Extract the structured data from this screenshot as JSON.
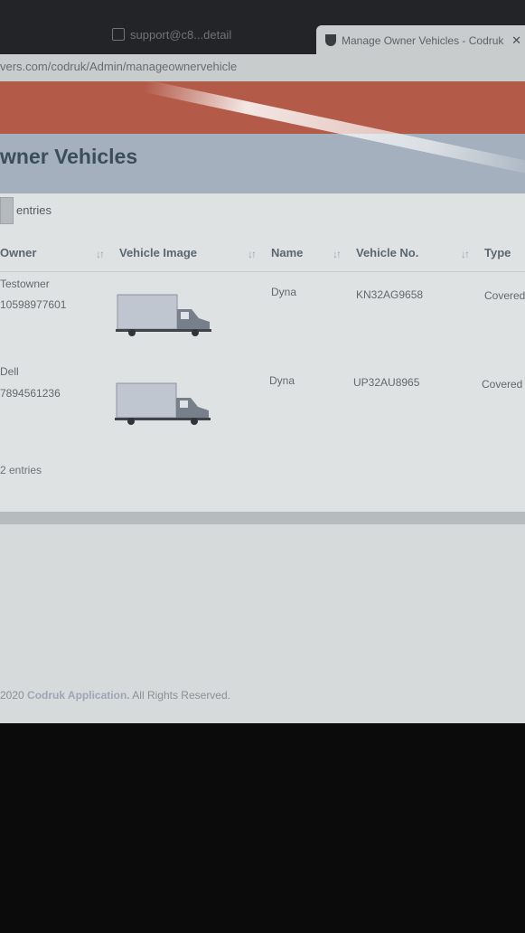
{
  "browser": {
    "tabs": [
      {
        "title": "support@c8...detail",
        "active": false
      },
      {
        "title": "Manage Owner Vehicles - Codruk",
        "active": true
      }
    ],
    "url": "vers.com/codruk/Admin/manageownervehicle"
  },
  "page": {
    "title": "wner Vehicles",
    "entries_label": "entries",
    "table": {
      "columns": [
        "Owner",
        "Vehicle Image",
        "Name",
        "Vehicle No.",
        "Type"
      ],
      "rows": [
        {
          "owner_name": "Testowner",
          "owner_phone": "10598977601",
          "image": "truck-icon",
          "name": "Dyna",
          "vehicle_no": "KN32AG9658",
          "type": "Covered"
        },
        {
          "owner_name": "Dell",
          "owner_phone": "7894561236",
          "image": "truck-icon",
          "name": "Dyna",
          "vehicle_no": "UP32AU8965",
          "type": "Covered"
        }
      ]
    },
    "info_text": "2 entries",
    "copyright": {
      "year": "2020",
      "brand": "Codruk Application.",
      "text": "All Rights Reserved."
    }
  },
  "colors": {
    "brand_red": "#b35a48",
    "title_bar": "#a4b0bd",
    "title_text": "#3d4d5c"
  }
}
